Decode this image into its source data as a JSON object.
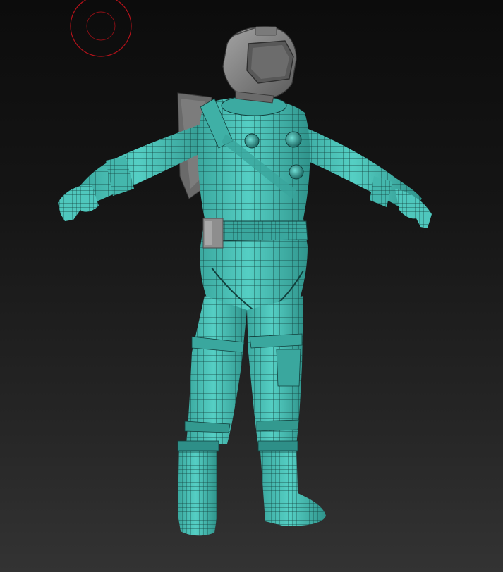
{
  "colors": {
    "suit": "#4fc7bd",
    "suit_dark": "#2e8f88",
    "suit_shadow": "#226e69",
    "wire": "#123f3c",
    "helmet": "#8c8c8c",
    "helmet_dark": "#555555",
    "backpack": "#6e6e6e",
    "pouch": "#9a9a9a",
    "brush_ring": "#b3121a"
  },
  "viewport": {
    "subject": "spacesuit-character-wireframe",
    "icons": {
      "brush_cursor": "brush-cursor-icon"
    }
  }
}
